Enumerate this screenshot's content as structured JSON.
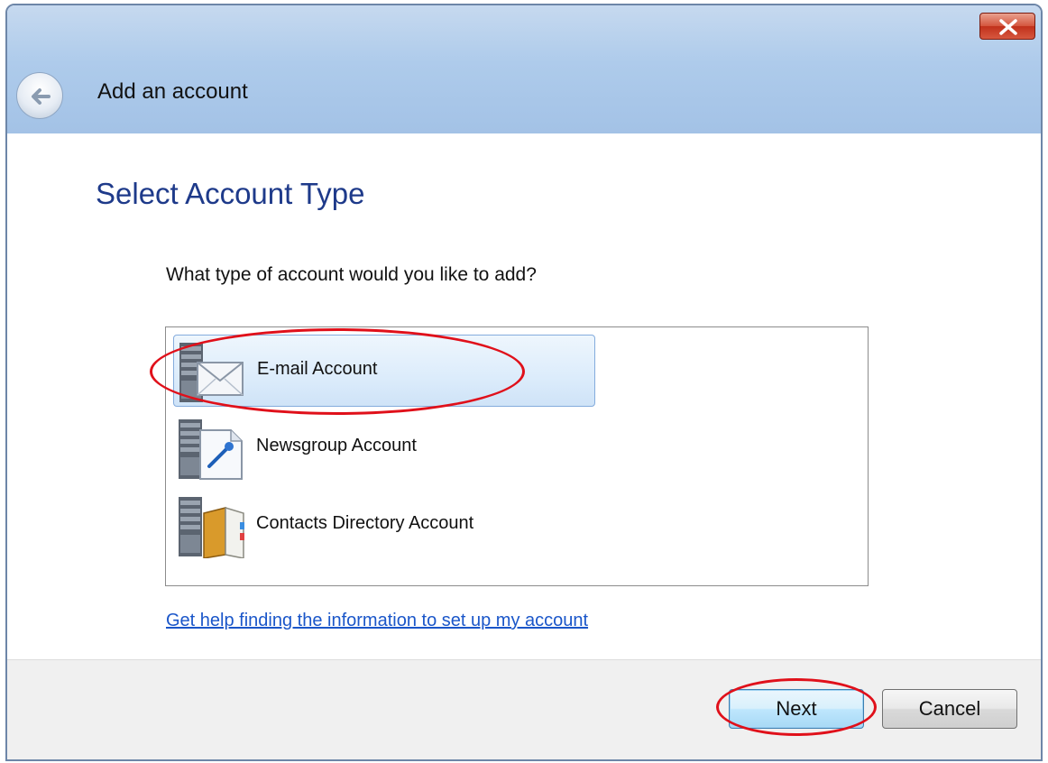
{
  "window": {
    "title": "Add an account",
    "close_icon": "close-icon",
    "back_icon": "back-arrow-icon"
  },
  "content": {
    "heading": "Select Account Type",
    "question": "What type of account would you like to add?",
    "account_types": [
      {
        "label": "E-mail Account",
        "icon": "email-server-icon",
        "selected": true
      },
      {
        "label": "Newsgroup Account",
        "icon": "newsgroup-server-icon",
        "selected": false
      },
      {
        "label": "Contacts Directory Account",
        "icon": "contacts-directory-server-icon",
        "selected": false
      }
    ],
    "help_link": "Get help finding the information to set up my account"
  },
  "footer": {
    "next_label": "Next",
    "cancel_label": "Cancel"
  },
  "colors": {
    "heading": "#1e3a8a",
    "link": "#1a56c9",
    "annotation": "#e0101a",
    "titlebar": "#aecbeb",
    "selection": "#dcecfb"
  }
}
